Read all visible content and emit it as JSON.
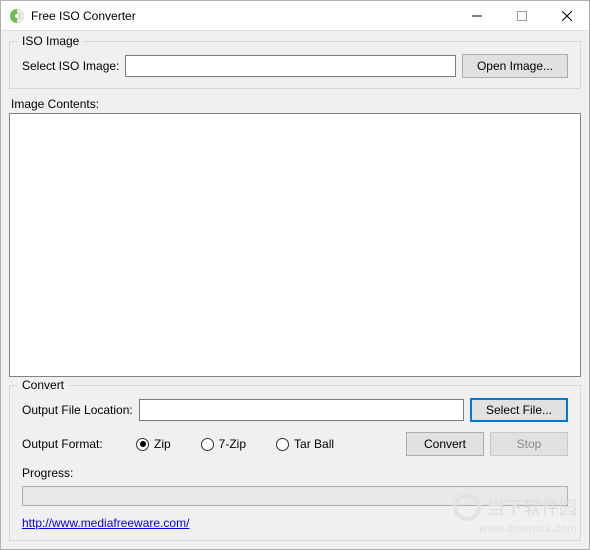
{
  "window": {
    "title": "Free ISO Converter"
  },
  "iso_group": {
    "title": "ISO Image",
    "select_label": "Select ISO Image:",
    "path_value": "",
    "open_button": "Open Image..."
  },
  "contents": {
    "label": "Image Contents:"
  },
  "convert_group": {
    "title": "Convert",
    "output_location_label": "Output File Location:",
    "output_location_value": "",
    "select_file_button": "Select File...",
    "output_format_label": "Output Format:",
    "formats": {
      "zip": "Zip",
      "sevenzip": "7-Zip",
      "tarball": "Tar Ball",
      "selected": "zip"
    },
    "convert_button": "Convert",
    "stop_button": "Stop",
    "progress_label": "Progress:"
  },
  "link": {
    "text": "http://www.mediafreeware.com/"
  },
  "watermark": {
    "text": "当下软件园",
    "sub": "www.downxia.com"
  }
}
